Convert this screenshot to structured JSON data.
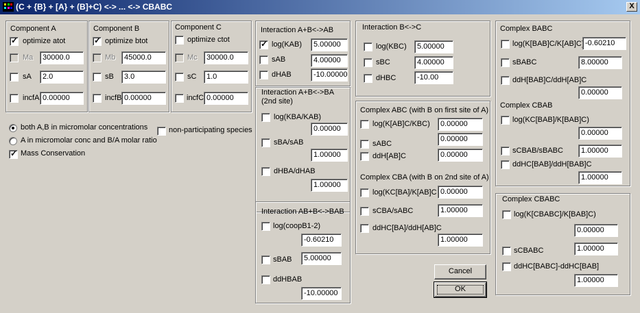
{
  "window": {
    "title": "(C + {B} + [A} + (B]+C) <-> ... <-> CBABC",
    "close_label": "X"
  },
  "componentA": {
    "title": "Component A",
    "optimize_label": "optimize atot",
    "m_label": "Ma",
    "m_value": "30000.0",
    "s_label": "sA",
    "s_value": "2.0",
    "incf_label": "incfA",
    "incf_value": "0.00000"
  },
  "componentB": {
    "title": "Component B",
    "optimize_label": "optimize btot",
    "m_label": "Mb",
    "m_value": "45000.0",
    "s_label": "sB",
    "s_value": "3.0",
    "incf_label": "incfB",
    "incf_value": "0.00000"
  },
  "componentC": {
    "title": "Component C",
    "optimize_label": "optimize ctot",
    "m_label": "Mc",
    "m_value": "30000.0",
    "s_label": "sC",
    "s_value": "1.0",
    "incf_label": "incfC",
    "incf_value": "0.00000"
  },
  "options": {
    "radio1": "both A,B in micromolar concentrations",
    "radio2": "A in micromolar conc and B/A molar ratio",
    "mass_conservation": "Mass Conservation",
    "non_participating": "non-participating species"
  },
  "interAB": {
    "title": "Interaction A+B<->AB",
    "logK_label": "log(KAB)",
    "logK_value": "5.00000",
    "s_label": "sAB",
    "s_value": "4.00000",
    "dH_label": "dHAB",
    "dH_value": "-10.00000"
  },
  "interBA": {
    "title": "Interaction A+B<->BA",
    "subtitle": "(2nd site)",
    "logK_label": "log(KBA/KAB)",
    "logK_value": "0.00000",
    "s_label": "sBA/sAB",
    "s_value": "1.00000",
    "dH_label": "dHBA/dHAB",
    "dH_value": "1.00000"
  },
  "interBAB": {
    "title": "Interaction AB+B<->BAB",
    "coop_label": "log(coopB1-2)",
    "coop_value": "-0.60210",
    "s_label": "sBAB",
    "s_value": "5.00000",
    "dH_label": "ddHBAB",
    "dH_value": "-10.00000"
  },
  "interBC": {
    "title": "Interaction B<->C",
    "logK_label": "log(KBC)",
    "logK_value": "5.00000",
    "s_label": "sBC",
    "s_value": "4.00000",
    "dH_label": "dHBC",
    "dH_value": "-10.00"
  },
  "complexABC": {
    "title": "Complex ABC (with B on first site of A)",
    "logK_label": "log(K[AB]C/KBC)",
    "logK_value": "0.00000",
    "s_label": "sABC",
    "s_value": "0.00000",
    "dH_label": "ddH[AB]C",
    "dH_value": "0.00000"
  },
  "complexCBA": {
    "title": "Complex CBA (with B on 2nd site of A)",
    "logK_label": "log(KC[BA]/K[AB]C",
    "logK_value": "0.00000",
    "s_label": "sCBA/sABC",
    "s_value": "1.00000",
    "dH_label": "ddHC[BA]/ddH[AB]C",
    "dH_value": "1.00000"
  },
  "complexBABC": {
    "title": "Complex BABC",
    "logK_label": "log(K[BAB]C/K[AB]C)",
    "logK_value": "-0.60210",
    "s_label": "sBABC",
    "s_value": "8.00000",
    "dH_label": "ddH[BAB]C/ddH[AB]C",
    "dH_value": "0.00000"
  },
  "complexCBAB": {
    "title": "Complex CBAB",
    "logK_label": "log(KC[BAB]/K[BAB]C)",
    "logK_value": "0.00000",
    "s_label": "sCBAB/sBABC",
    "s_value": "1.00000",
    "dH_label": "ddHC[BAB]/ddH[BAB]C",
    "dH_value": "1.00000"
  },
  "complexCBABC": {
    "title": "Complex CBABC",
    "logK_label": "log(K[CBABC]/K[BAB]C)",
    "logK_value": "0.00000",
    "s_label": "sCBABC",
    "s_value": "1.00000",
    "dH_label": "ddHC[BABC]-ddHC[BAB]",
    "dH_value": "1.00000"
  },
  "buttons": {
    "cancel": "Cancel",
    "ok": "OK"
  }
}
